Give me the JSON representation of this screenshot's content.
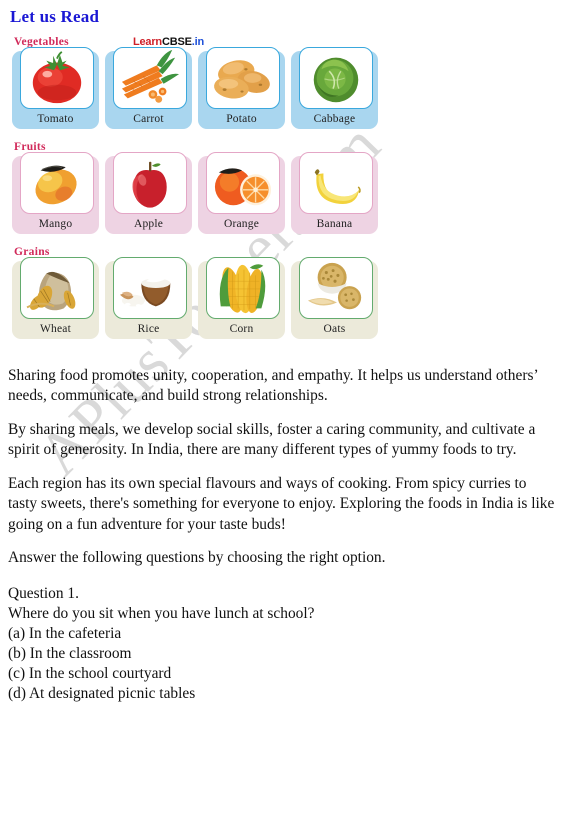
{
  "title": "Let us Read",
  "watermark": "APlusTopper.com",
  "source_mark": {
    "part1": "Learn",
    "part2": "CBSE",
    "part3": ".in"
  },
  "chart_data": {
    "type": "table",
    "title": "Let us Read",
    "categories": [
      "Vegetables",
      "Fruits",
      "Grains"
    ],
    "groups": [
      {
        "label": "Vegetables",
        "accent": "#3aa8dd",
        "panel": "#a9d6ef",
        "items": [
          {
            "label": "Tomato",
            "icon": "tomato-icon"
          },
          {
            "label": "Carrot",
            "icon": "carrot-icon"
          },
          {
            "label": "Potato",
            "icon": "potato-icon"
          },
          {
            "label": "Cabbage",
            "icon": "cabbage-icon"
          }
        ]
      },
      {
        "label": "Fruits",
        "accent": "#e4a6c6",
        "panel": "#eed3e3",
        "items": [
          {
            "label": "Mango",
            "icon": "mango-icon"
          },
          {
            "label": "Apple",
            "icon": "apple-icon"
          },
          {
            "label": "Orange",
            "icon": "orange-icon"
          },
          {
            "label": "Banana",
            "icon": "banana-icon"
          }
        ]
      },
      {
        "label": "Grains",
        "accent": "#63ab6e",
        "panel": "#eceada",
        "items": [
          {
            "label": "Wheat",
            "icon": "wheat-icon"
          },
          {
            "label": "Rice",
            "icon": "rice-icon"
          },
          {
            "label": "Corn",
            "icon": "corn-icon"
          },
          {
            "label": "Oats",
            "icon": "oats-icon"
          }
        ]
      }
    ]
  },
  "paragraphs": [
    "Sharing food promotes unity, cooperation, and empathy. It helps us understand others’ needs, communicate, and build strong relationships.",
    "By sharing meals, we develop social skills, foster a caring community, and cultivate a spirit of generosity. In India, there are many different types of yummy foods to try.",
    "Each region has its own special flavours and ways of cooking. From spicy curries to tasty sweets, there's something for everyone to enjoy. Exploring the foods in India is like going on a fun adventure for your taste buds!",
    "Answer the following questions by choosing the right option."
  ],
  "question": {
    "number": "Question 1.",
    "text": "Where do you sit when you have lunch at school?",
    "options": [
      "(a) In the cafeteria",
      "(b) In the classroom",
      "(c) In the school courtyard",
      "(d) At designated picnic tables"
    ]
  },
  "colors": {
    "title": "#1a17d4",
    "category_label": "#d12a5a",
    "watermark": "#d9d9d9"
  }
}
